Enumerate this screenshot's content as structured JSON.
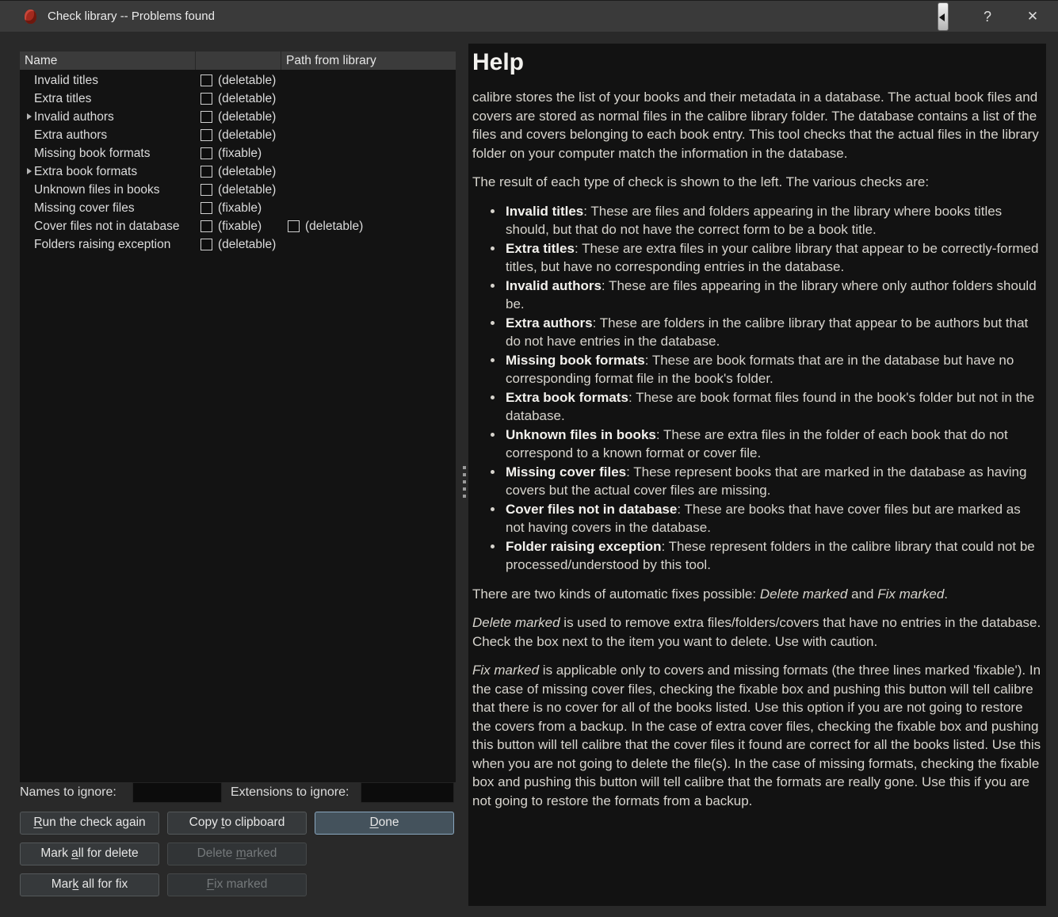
{
  "window": {
    "title": "Check library -- Problems found",
    "help_glyph": "?",
    "close_glyph": "✕"
  },
  "colors": {
    "titlebar": "#3a3a3a",
    "dialog_bg": "#292929",
    "panel_bg": "#131313",
    "header_bg": "#3b3b3b",
    "button_bg": "#36393b",
    "default_button_border": "#8aa7bf",
    "calibre_icon_red": "#a32a1e",
    "text": "#dcdcdc"
  },
  "tree": {
    "columns": [
      "Name",
      "",
      "Path from library"
    ],
    "rows": [
      {
        "label": "Invalid titles",
        "status1": "(deletable)"
      },
      {
        "label": "Extra titles",
        "status1": "(deletable)"
      },
      {
        "label": "Invalid authors",
        "status1": "(deletable)"
      },
      {
        "label": "Extra authors",
        "status1": "(deletable)"
      },
      {
        "label": "Missing book formats",
        "status1": "(fixable)"
      },
      {
        "label": "Extra book formats",
        "status1": "(deletable)"
      },
      {
        "label": "Unknown files in books",
        "status1": "(deletable)"
      },
      {
        "label": "Missing cover files",
        "status1": "(fixable)"
      },
      {
        "label": "Cover files not in database",
        "status1": "(fixable)",
        "status2": "(deletable)"
      },
      {
        "label": "Folders raising exception",
        "status1": "(deletable)"
      }
    ]
  },
  "ignore": {
    "names_label": "Names to ignore:",
    "names_value": "",
    "extensions_label": "Extensions to ignore:",
    "extensions_value": ""
  },
  "buttons": {
    "run": {
      "pre": "",
      "key": "R",
      "post": "un the check again"
    },
    "copy": {
      "pre": "Copy ",
      "key": "t",
      "post": "o clipboard"
    },
    "done": {
      "pre": "",
      "key": "D",
      "post": "one"
    },
    "mark_delete": {
      "pre": "Mark ",
      "key": "a",
      "post": "ll for delete"
    },
    "delete_marked": {
      "pre": "Delete ",
      "key": "m",
      "post": "arked"
    },
    "mark_fix": {
      "pre": "Mar",
      "key": "k",
      "post": " all for fix"
    },
    "fix_marked": {
      "pre": "",
      "key": "F",
      "post": "ix marked"
    }
  },
  "help": {
    "heading": "Help",
    "intro": "calibre stores the list of your books and their metadata in a database. The actual book files and covers are stored as normal files in the calibre library folder. The database contains a list of the files and covers belonging to each book entry. This tool checks that the actual files in the library folder on your computer match the information in the database.",
    "checks_lead": "The result of each type of check is shown to the left. The various checks are:",
    "bullets": [
      {
        "term": "Invalid titles",
        "desc": ": These are files and folders appearing in the library where books titles should, but that do not have the correct form to be a book title."
      },
      {
        "term": "Extra titles",
        "desc": ": These are extra files in your calibre library that appear to be correctly-formed titles, but have no corresponding entries in the database."
      },
      {
        "term": "Invalid authors",
        "desc": ": These are files appearing in the library where only author folders should be."
      },
      {
        "term": "Extra authors",
        "desc": ": These are folders in the calibre library that appear to be authors but that do not have entries in the database."
      },
      {
        "term": "Missing book formats",
        "desc": ": These are book formats that are in the database but have no corresponding format file in the book's folder."
      },
      {
        "term": "Extra book formats",
        "desc": ": These are book format files found in the book's folder but not in the database."
      },
      {
        "term": "Unknown files in books",
        "desc": ": These are extra files in the folder of each book that do not correspond to a known format or cover file."
      },
      {
        "term": "Missing cover files",
        "desc": ": These represent books that are marked in the database as having covers but the actual cover files are missing."
      },
      {
        "term": "Cover files not in database",
        "desc": ": These are books that have cover files but are marked as not having covers in the database."
      },
      {
        "term": "Folder raising exception",
        "desc": ": These represent folders in the calibre library that could not be processed/understood by this tool."
      }
    ],
    "fixes": {
      "pre": "There are two kinds of automatic fixes possible: ",
      "italic1": "Delete marked",
      "mid": " and ",
      "italic2": "Fix marked",
      "post": "."
    },
    "delete_para": {
      "italic": "Delete marked",
      "rest": " is used to remove extra files/folders/covers that have no entries in the database. Check the box next to the item you want to delete. Use with caution."
    },
    "fix_para": {
      "italic": "Fix marked",
      "rest": " is applicable only to covers and missing formats (the three lines marked 'fixable'). In the case of missing cover files, checking the fixable box and pushing this button will tell calibre that there is no cover for all of the books listed. Use this option if you are not going to restore the covers from a backup. In the case of extra cover files, checking the fixable box and pushing this button will tell calibre that the cover files it found are correct for all the books listed. Use this when you are not going to delete the file(s). In the case of missing formats, checking the fixable box and pushing this button will tell calibre that the formats are really gone. Use this if you are not going to restore the formats from a backup."
    }
  }
}
